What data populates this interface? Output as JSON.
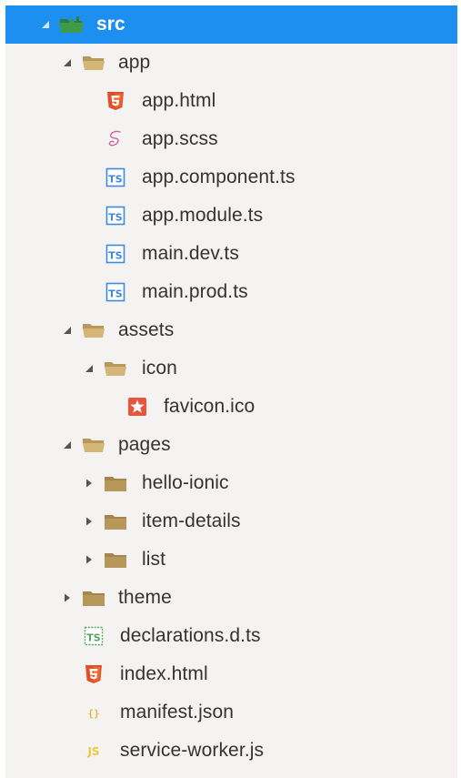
{
  "colors": {
    "selection": "#1d8ff0",
    "folder": "#c9a86a",
    "html5": "#e44d26",
    "sass": "#cf649a",
    "typescript": "#3e8ad8",
    "json": "#e8b54a",
    "js": "#f0db4f",
    "favicon": "#e8553e"
  },
  "tree": {
    "items": [
      {
        "label": "src",
        "depth": 0,
        "expanded": true,
        "icon": "folder-open-green-icon"
      },
      {
        "label": "app",
        "depth": 1,
        "expanded": true,
        "icon": "folder-open-icon"
      },
      {
        "label": "app.html",
        "depth": 2,
        "icon": "html5-icon"
      },
      {
        "label": "app.scss",
        "depth": 2,
        "icon": "sass-icon"
      },
      {
        "label": "app.component.ts",
        "depth": 2,
        "icon": "typescript-icon"
      },
      {
        "label": "app.module.ts",
        "depth": 2,
        "icon": "typescript-icon"
      },
      {
        "label": "main.dev.ts",
        "depth": 2,
        "icon": "typescript-icon"
      },
      {
        "label": "main.prod.ts",
        "depth": 2,
        "icon": "typescript-icon"
      },
      {
        "label": "assets",
        "depth": 1,
        "expanded": true,
        "icon": "folder-open-icon"
      },
      {
        "label": "icon",
        "depth": 2,
        "expanded": true,
        "icon": "folder-open-icon"
      },
      {
        "label": "favicon.ico",
        "depth": 3,
        "icon": "favicon-icon"
      },
      {
        "label": "pages",
        "depth": 1,
        "expanded": true,
        "icon": "folder-open-icon"
      },
      {
        "label": "hello-ionic",
        "depth": 2,
        "expanded": false,
        "icon": "folder-closed-icon"
      },
      {
        "label": "item-details",
        "depth": 2,
        "expanded": false,
        "icon": "folder-closed-icon"
      },
      {
        "label": "list",
        "depth": 2,
        "expanded": false,
        "icon": "folder-closed-icon"
      },
      {
        "label": "theme",
        "depth": 1,
        "expanded": false,
        "icon": "folder-closed-icon"
      },
      {
        "label": "declarations.d.ts",
        "depth": 1,
        "icon": "typescript-definition-icon"
      },
      {
        "label": "index.html",
        "depth": 1,
        "icon": "html5-icon"
      },
      {
        "label": "manifest.json",
        "depth": 1,
        "icon": "json-icon"
      },
      {
        "label": "service-worker.js",
        "depth": 1,
        "icon": "javascript-icon"
      }
    ]
  }
}
